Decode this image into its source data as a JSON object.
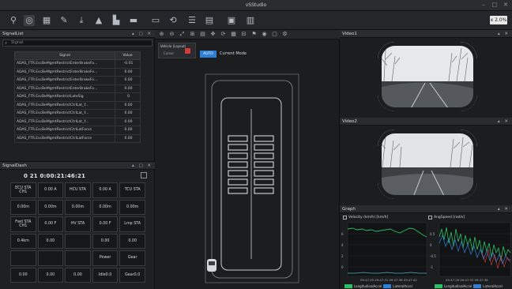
{
  "window": {
    "title": "vSStudio"
  },
  "toolbar": {
    "icons": [
      "pin-icon",
      "layout-icon",
      "grid-icon",
      "tool-icon",
      "download-icon",
      "chart-icon",
      "chart-bars-icon",
      "folder-icon",
      "monitor-icon",
      "sync-icon",
      "panel-icon",
      "document-icon",
      "doc-split-icon"
    ],
    "speed": "x 2.0%"
  },
  "signal_panel": {
    "title": "SignalList",
    "filter_placeholder": "Signal",
    "headers": {
      "signal": "Signal",
      "value": "Value"
    },
    "rows": [
      {
        "name": "ADAS_FTR.EscBeMgmtRestrictEnterBrakeFo...",
        "value": "-0.01"
      },
      {
        "name": "ADAS_FTR.EscBeMgmtRestrictEnterBrakeFo...",
        "value": "0.00"
      },
      {
        "name": "ADAS_FTR.EscBeMgmtRestrictEnterBrakeFo...",
        "value": "0.00"
      },
      {
        "name": "ADAS_FTR.EscBeMgmtRestrictEnterBrakeFo...",
        "value": "0.00"
      },
      {
        "name": "ADAS_FTR.EscBeMgmtRestrictLateSig",
        "value": "0"
      },
      {
        "name": "ADAS_FTR.EscBeMgmtRestrictCtrlLat_Y...",
        "value": "0.00"
      },
      {
        "name": "ADAS_FTR.EscBeMgmtRestrictCtrlLat_Y...",
        "value": "0.00"
      },
      {
        "name": "ADAS_FTR.EscBeMgmtRestrictCtrlLat_Y...",
        "value": "0.00"
      },
      {
        "name": "ADAS_FTR.EscBeMgmtRestrictCtrlLatForce",
        "value": "0.00"
      },
      {
        "name": "ADAS_FTR.EscBeMgmtRestrictCtrlLatForce",
        "value": "0.00"
      }
    ]
  },
  "dash_panel": {
    "title": "SignalDash",
    "headline": "0 21 0:00:21:46:21 ",
    "cells": [
      "ECU STA CH1",
      "0.00 A",
      "HCU STA",
      "0.00 A",
      "TCU STA",
      "0.00m",
      "0.00m",
      "0.00m",
      "0.00m",
      "0.00m",
      "Fwd STA CH1",
      "0.00 F",
      "HV STA",
      "0.00 F",
      "Lmp STA",
      "0.4km",
      "0.00",
      "",
      "0.00",
      "0.00",
      "",
      "",
      "",
      "Power",
      "Gear",
      "0.00",
      "0.00",
      "0.00",
      "Idle0.0",
      "Gear0.0"
    ]
  },
  "map_panel": {
    "tab_title": "Vehicle (Layout)",
    "tab_sub": "Cursor",
    "badge": "AUTO",
    "status_text": "Current Mode",
    "tool_icons": [
      "zoom-in-icon",
      "zoom-out-icon",
      "fit-icon",
      "ruler-icon",
      "layers-icon",
      "pan-icon",
      "rotate-icon",
      "grid-toggle-icon",
      "measure-icon",
      "flag-icon",
      "target-icon",
      "camera-icon",
      "settings-icon"
    ]
  },
  "video1": {
    "title": "Video1"
  },
  "video2": {
    "title": "Video2"
  },
  "graph_panel": {
    "title": "Graph",
    "legend_left": "Velocity (km/h) [km/h]",
    "legend_right": "AngSpeed [rad/s]",
    "foot_left_a": "LongitudinalAccel",
    "foot_left_b": "LateralAccel",
    "foot_right_a": "LongitudinalAccel",
    "foot_right_b": "LateralAccel",
    "time_left": "09:47:25  09:47:31  09:47:36  09:47:42",
    "time_right": "09:47:28  09:47:33  09:47:38"
  },
  "colors": {
    "accent": "#2f7fd8",
    "green": "#2bbf66",
    "teal": "#4fb3c8",
    "red": "#d83a3a"
  }
}
